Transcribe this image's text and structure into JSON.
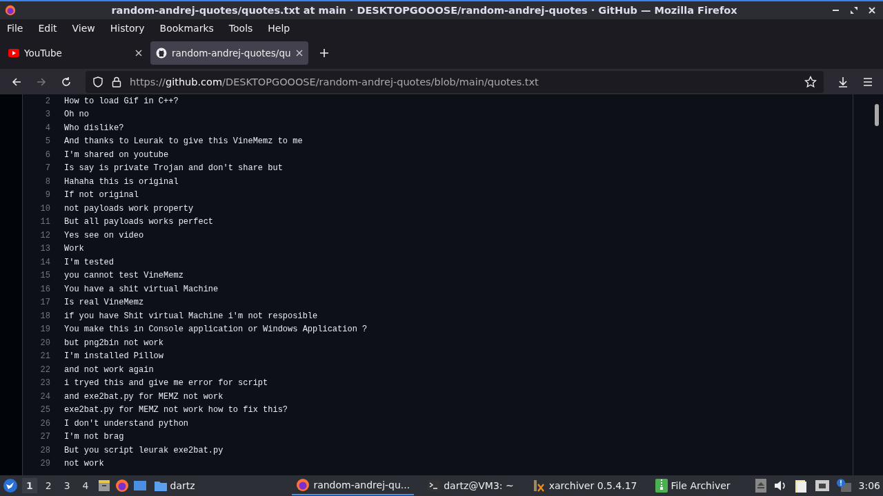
{
  "window": {
    "title": "random-andrej-quotes/quotes.txt at main · DESKTOPGOOOSE/random-andrej-quotes · GitHub — Mozilla Firefox"
  },
  "menu": [
    "File",
    "Edit",
    "View",
    "History",
    "Bookmarks",
    "Tools",
    "Help"
  ],
  "tabs": [
    {
      "kind": "youtube",
      "label": "YouTube",
      "selected": false
    },
    {
      "kind": "github",
      "label": "random-andrej-quotes/qu",
      "selected": true
    }
  ],
  "address_bar": {
    "scheme": "https://",
    "domain": "github.com",
    "path": "/DESKTOPGOOOSE/random-andrej-quotes/blob/main/quotes.txt"
  },
  "lines": [
    {
      "number": "2",
      "text": "How to load Gif in C++?"
    },
    {
      "number": "3",
      "text": "Oh no"
    },
    {
      "number": "4",
      "text": "Who dislike?"
    },
    {
      "number": "5",
      "text": "And thanks to Leurak to give this VineMemz to me"
    },
    {
      "number": "6",
      "text": "I'm shared on youtube"
    },
    {
      "number": "7",
      "text": "Is say is private Trojan and don't share but"
    },
    {
      "number": "8",
      "text": "Hahaha this is original"
    },
    {
      "number": "9",
      "text": "If not original"
    },
    {
      "number": "10",
      "text": "not payloads work property"
    },
    {
      "number": "11",
      "text": "But all payloads works perfect"
    },
    {
      "number": "12",
      "text": "Yes see on video"
    },
    {
      "number": "13",
      "text": "Work"
    },
    {
      "number": "14",
      "text": "I'm tested"
    },
    {
      "number": "15",
      "text": "you cannot test VineMemz"
    },
    {
      "number": "16",
      "text": "You have a shit virtual Machine"
    },
    {
      "number": "17",
      "text": "Is real VineMemz"
    },
    {
      "number": "18",
      "text": "if you have Shit virtual Machine i'm not resposible"
    },
    {
      "number": "19",
      "text": "You make this in Console application or Windows Application ?"
    },
    {
      "number": "20",
      "text": "but png2bin not work"
    },
    {
      "number": "21",
      "text": "I'm installed Pillow"
    },
    {
      "number": "22",
      "text": "and not work again"
    },
    {
      "number": "23",
      "text": "i tryed this and give me error for script"
    },
    {
      "number": "24",
      "text": "and exe2bat.py for MEMZ not work"
    },
    {
      "number": "25",
      "text": "exe2bat.py for MEMZ not work how to fix this?"
    },
    {
      "number": "26",
      "text": "I don't understand python"
    },
    {
      "number": "27",
      "text": "I'm not brag"
    },
    {
      "number": "28",
      "text": "But you script leurak exe2bat.py"
    },
    {
      "number": "29",
      "text": "not work"
    }
  ],
  "taskbar": {
    "workspaces": [
      {
        "label": "1",
        "selected": true
      },
      {
        "label": "2",
        "selected": false
      },
      {
        "label": "3",
        "selected": false
      },
      {
        "label": "4",
        "selected": false
      }
    ],
    "launcher_label": "dartz",
    "tasks": [
      {
        "kind": "firefox",
        "label": "random-andrej-qu...",
        "selected": true
      },
      {
        "kind": "terminal",
        "label": "dartz@VM3: ~",
        "selected": false
      },
      {
        "kind": "xarchiver",
        "label": "xarchiver 0.5.4.17",
        "selected": false
      },
      {
        "kind": "archive",
        "label": "File Archiver",
        "selected": false
      }
    ],
    "clock": "3:06"
  }
}
